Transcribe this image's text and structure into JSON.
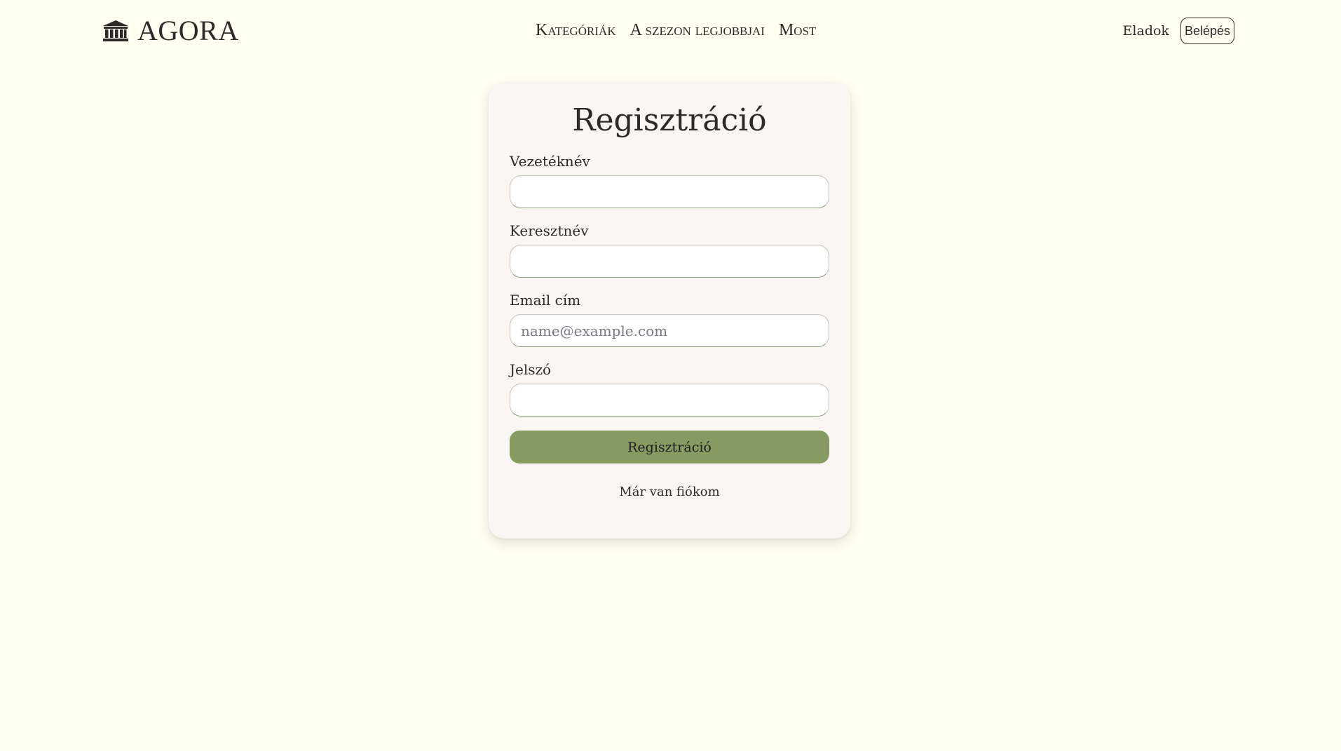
{
  "header": {
    "brand": {
      "icon": "temple-icon",
      "name": "AGORA"
    },
    "nav": [
      {
        "label": "Kategóriák"
      },
      {
        "label": "A szezon legjobbjai"
      },
      {
        "label": "Most"
      }
    ],
    "sell_label": "Eladok",
    "login_label": "Belépés"
  },
  "form": {
    "title": "Regisztráció",
    "fields": {
      "last_name": {
        "label": "Vezetéknév",
        "value": "",
        "placeholder": ""
      },
      "first_name": {
        "label": "Keresztnév",
        "value": "",
        "placeholder": ""
      },
      "email": {
        "label": "Email cím",
        "value": "",
        "placeholder": "name@example.com"
      },
      "password": {
        "label": "Jelszó",
        "value": "",
        "placeholder": ""
      }
    },
    "submit_label": "Regisztráció",
    "have_account_label": "Már van fiókom"
  },
  "colors": {
    "background": "#fffff2",
    "card": "#f9f6f3",
    "accent": "#859b62",
    "text": "#2f2a28"
  }
}
